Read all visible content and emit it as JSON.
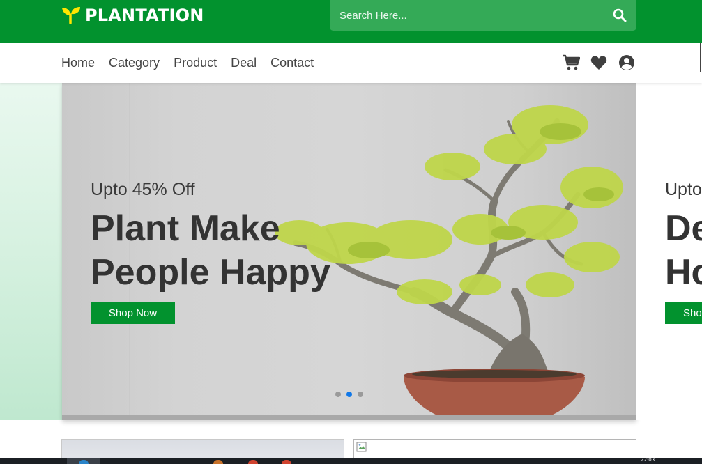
{
  "header": {
    "logo_text": "PLANTATION",
    "logo_icon": "sprout-icon",
    "search_placeholder": "Search Here...",
    "search_icon": "search-icon",
    "brand_color": "#02922e"
  },
  "nav": {
    "links": [
      "Home",
      "Category",
      "Product",
      "Deal",
      "Contact"
    ],
    "icons": [
      "cart-icon",
      "heart-icon",
      "user-circle-icon"
    ]
  },
  "hero": {
    "active_slide": 2,
    "slide_count": 3,
    "slide": {
      "subtitle": "Upto 45% Off",
      "title_line1": "Plant Make",
      "title_line2": "People Happy",
      "button": "Shop Now"
    },
    "next_slide": {
      "subtitle": "Upto",
      "title_line1": "De",
      "title_line2": "Ho",
      "button": "Sho"
    }
  },
  "taskbar": {
    "clock": "22:03"
  }
}
